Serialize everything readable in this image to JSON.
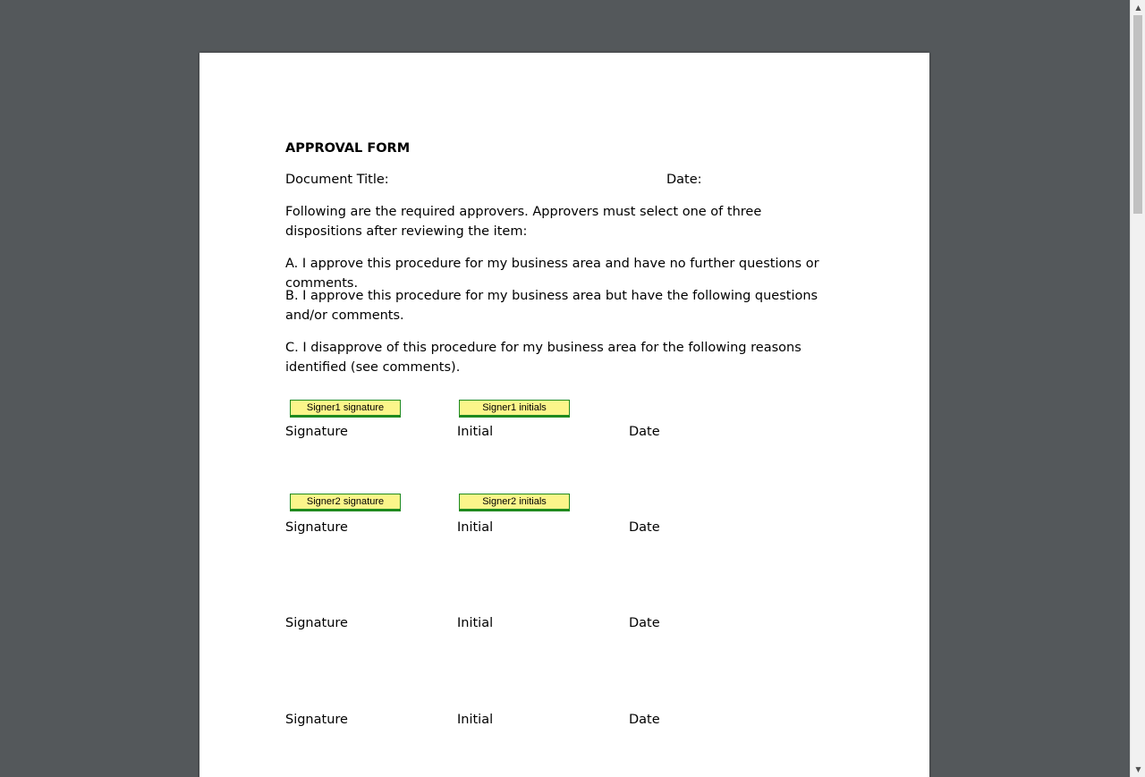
{
  "document": {
    "title": "APPROVAL FORM",
    "doc_title_label": "Document Title:",
    "date_label": "Date:",
    "intro": "Following are the required approvers. Approvers must select one of three dispositions after reviewing the item:",
    "option_a": "A. I approve this procedure for my business area and have no further questions or comments.",
    "option_b": "B. I approve this procedure for my business area but have the following questions and/or comments.",
    "option_c": "C. I disapprove of this procedure for my business area for the following reasons identified (see comments).",
    "rows": [
      {
        "signature": "Signature",
        "initial": "Initial",
        "date": "Date",
        "sig_field": "Signer1 signature",
        "init_field": "Signer1 initials"
      },
      {
        "signature": "Signature",
        "initial": "Initial",
        "date": "Date",
        "sig_field": "Signer2 signature",
        "init_field": "Signer2 initials"
      },
      {
        "signature": "Signature",
        "initial": "Initial",
        "date": "Date"
      },
      {
        "signature": "Signature",
        "initial": "Initial",
        "date": "Date"
      }
    ]
  },
  "scrollbar": {
    "up_arrow": "▲",
    "down_arrow": "▼"
  },
  "colors": {
    "viewer_bg": "#54585b",
    "field_fill": "#fbf58a",
    "field_border": "#1f8a1f"
  }
}
